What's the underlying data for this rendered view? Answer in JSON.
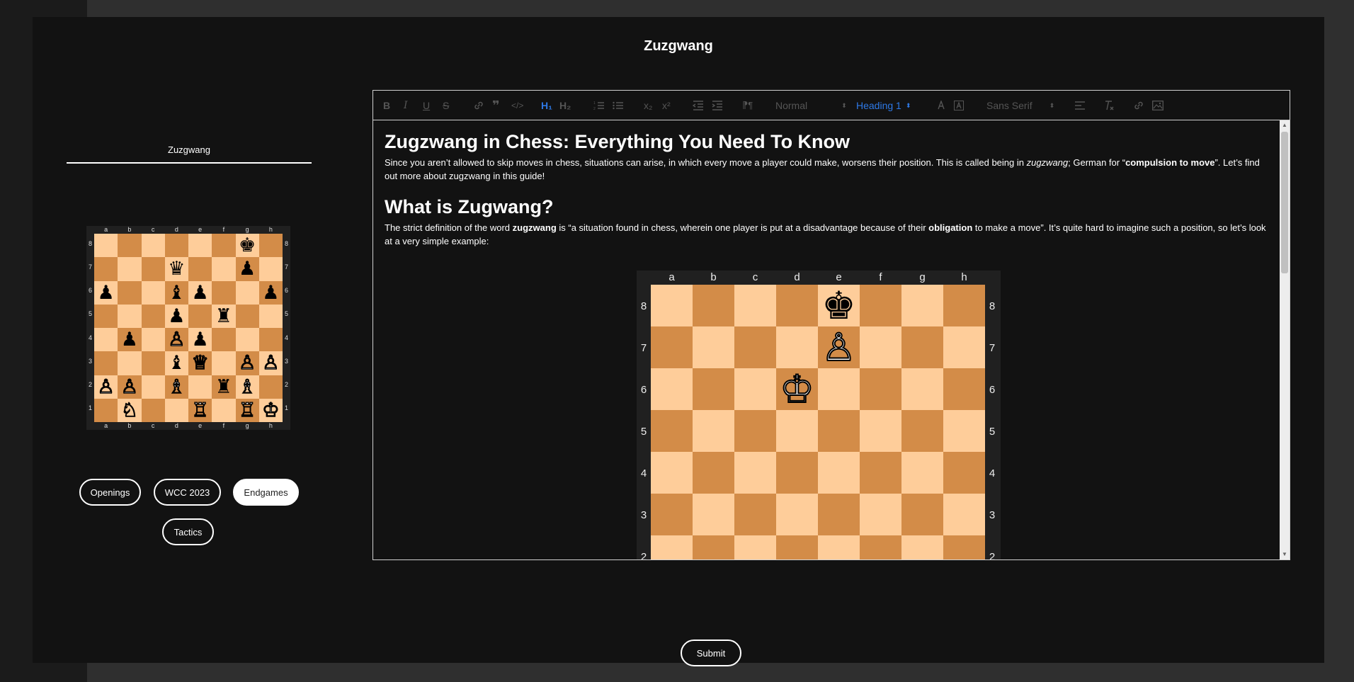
{
  "page": {
    "title": "Zuzgwang"
  },
  "tab": {
    "label": "Zuzgwang"
  },
  "mini_board": {
    "files": [
      "a",
      "b",
      "c",
      "d",
      "e",
      "f",
      "g",
      "h"
    ],
    "ranks": [
      "8",
      "7",
      "6",
      "5",
      "4",
      "3",
      "2",
      "1"
    ],
    "rows": [
      [
        "",
        "",
        "",
        "",
        "",
        "",
        "♚",
        ""
      ],
      [
        "",
        "",
        "",
        "♛",
        "",
        "",
        "♟",
        ""
      ],
      [
        "♟",
        "",
        "",
        "♝",
        "♟",
        "",
        "",
        "♟"
      ],
      [
        "",
        "",
        "",
        "♟",
        "",
        "♜",
        "",
        ""
      ],
      [
        "",
        "♟",
        "",
        "♙",
        "♟",
        "",
        "",
        ""
      ],
      [
        "",
        "",
        "",
        "♝",
        "♕",
        "",
        "♙",
        "♙"
      ],
      [
        "♙",
        "♙",
        "",
        "♗",
        "",
        "♜",
        "♗",
        ""
      ],
      [
        "",
        "♘",
        "",
        "",
        "♖",
        "",
        "♖",
        "♔"
      ]
    ]
  },
  "categories": [
    "Openings",
    "WCC 2023",
    "Endgames",
    "Tactics"
  ],
  "toolbar": {
    "header_select": "Normal",
    "heading_select": "Heading 1",
    "font_select": "Sans Serif",
    "h1": "H₁",
    "h2": "H₂",
    "sub": "x₂",
    "sup": "x²"
  },
  "content": {
    "heading1": "Zugzwang in Chess: Everything You Need To Know",
    "para1_a": "Since you aren’t allowed to skip moves in chess, situations can arise, in which every move a player could make, worsens their position. This is called being in ",
    "para1_em": "zugzwang",
    "para1_b": "; German for “",
    "para1_strong": "compulsion to move",
    "para1_c": "”. Let’s find out more about zugzwang in this guide!",
    "heading2": "What is Zugwang?",
    "para2_a": "The strict definition of the word ",
    "para2_strong1": "zugzwang",
    "para2_b": " is “a situation found in chess, wherein one player is put at a disadvantage because of their ",
    "para2_strong2": "obligation",
    "para2_c": " to make a move”. It’s quite hard to imagine such a position, so let’s look at a very simple example:"
  },
  "big_board": {
    "files": [
      "a",
      "b",
      "c",
      "d",
      "e",
      "f",
      "g",
      "h"
    ],
    "ranks": [
      "8",
      "7",
      "6",
      "5",
      "4",
      "3",
      "2"
    ],
    "rows": [
      [
        "",
        "",
        "",
        "",
        "♚",
        "",
        "",
        ""
      ],
      [
        "",
        "",
        "",
        "",
        "♙",
        "",
        "",
        ""
      ],
      [
        "",
        "",
        "",
        "♔",
        "",
        "",
        "",
        ""
      ],
      [
        "",
        "",
        "",
        "",
        "",
        "",
        "",
        ""
      ],
      [
        "",
        "",
        "",
        "",
        "",
        "",
        "",
        ""
      ],
      [
        "",
        "",
        "",
        "",
        "",
        "",
        "",
        ""
      ],
      [
        "",
        "",
        "",
        "",
        "",
        "",
        "",
        ""
      ],
      [
        "",
        "",
        "",
        "",
        "",
        "",
        "",
        ""
      ]
    ]
  },
  "submit": {
    "label": "Submit"
  },
  "colors": {
    "light_square": "#fecd9a",
    "dark_square": "#d38c48",
    "active": "#2e79e6"
  }
}
